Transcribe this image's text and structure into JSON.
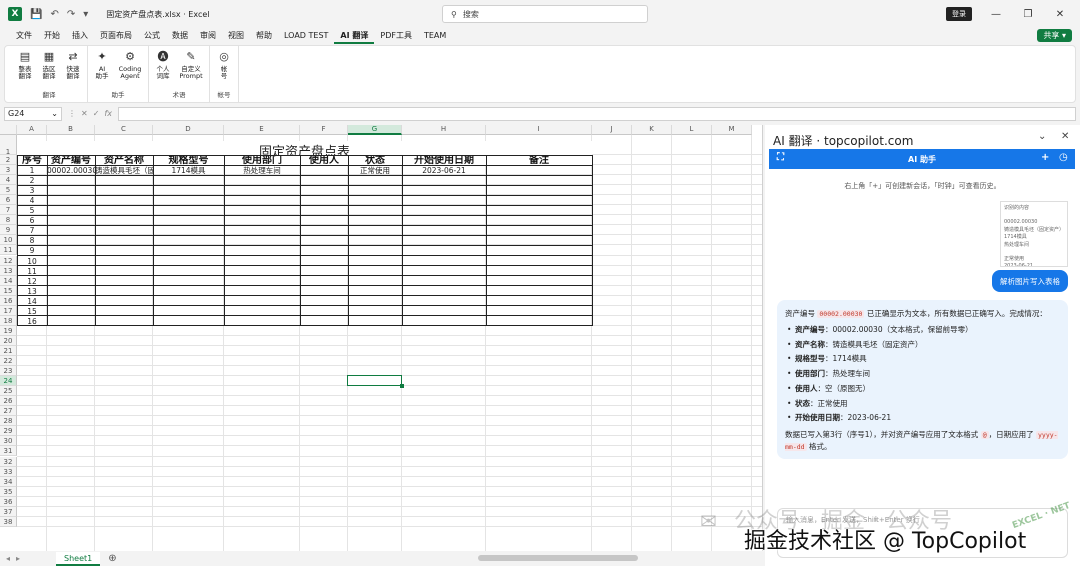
{
  "window": {
    "title": "固定资产盘点表.xlsx · Excel",
    "search_placeholder": "搜索",
    "login_label": "登录",
    "share_label": "共享"
  },
  "menu": [
    "文件",
    "开始",
    "插入",
    "页面布局",
    "公式",
    "数据",
    "审阅",
    "视图",
    "帮助",
    "LOAD TEST",
    "AI 翻译",
    "PDF工具",
    "TEAM"
  ],
  "menu_active": "AI 翻译",
  "ribbon": {
    "groups": [
      {
        "label": "翻译",
        "buttons": [
          [
            "整表",
            "翻译"
          ],
          [
            "选区",
            "翻译"
          ],
          [
            "快速",
            "翻译"
          ]
        ]
      },
      {
        "label": "助手",
        "buttons": [
          [
            "AI",
            "助手"
          ],
          [
            "Coding",
            "Agent"
          ]
        ]
      },
      {
        "label": "术语",
        "buttons": [
          [
            "个人",
            "词库"
          ],
          [
            "自定义",
            "Prompt"
          ]
        ]
      },
      {
        "label": "帐号",
        "buttons": [
          [
            "帐",
            "号"
          ]
        ]
      }
    ]
  },
  "formula": {
    "namebox": "G24",
    "fx": "fx"
  },
  "columns": [
    "A",
    "B",
    "C",
    "D",
    "E",
    "F",
    "G",
    "H",
    "I",
    "J",
    "K",
    "L",
    "M"
  ],
  "sheet": {
    "title": "固定资产盘点表",
    "headers": [
      "序号",
      "资产编号",
      "资产名称",
      "规格型号",
      "使用部门",
      "使用人",
      "状态",
      "开始使用日期",
      "备注"
    ],
    "row1": {
      "seq": "1",
      "code": "00002.00030",
      "name": "铸造模具毛坯（固定资产）",
      "spec": "1714模具",
      "dept": "热处理车间",
      "user": "",
      "status": "正常使用",
      "date": "2023-06-21"
    },
    "seq_numbers": [
      "2",
      "3",
      "4",
      "5",
      "6",
      "7",
      "8",
      "9",
      "10",
      "11",
      "12",
      "13",
      "14",
      "15",
      "16"
    ],
    "tab_name": "Sheet1"
  },
  "panel": {
    "title": "AI 翻译 · topcopilot.com",
    "assistant_title": "AI 助手",
    "hint": "右上角「+」可创建新会话，「时钟」可查看历史。",
    "thumb_lines": [
      "识别的内容",
      "",
      "00002.00030",
      "铸造模具毛坯（固定资产）",
      "1714模具",
      "热处理车间",
      "",
      "正常使用",
      "2023-06-21"
    ],
    "user_message": "解析图片写入表格",
    "reply_intro_a": "资产编号",
    "reply_intro_code": "00002.00030",
    "reply_intro_b": "已正确显示为文本，所有数据已正确写入。完成情况：",
    "reply_items": [
      {
        "k": "资产编号",
        "v": "：00002.00030（文本格式，保留前导零）"
      },
      {
        "k": "资产名称",
        "v": "：铸造模具毛坯（固定资产）"
      },
      {
        "k": "规格型号",
        "v": "：1714模具"
      },
      {
        "k": "使用部门",
        "v": "：热处理车间"
      },
      {
        "k": "使用人",
        "v": "：空（原图无）"
      },
      {
        "k": "状态",
        "v": "：正常使用"
      },
      {
        "k": "开始使用日期",
        "v": "：2023-06-21"
      }
    ],
    "reply_outro_a": "数据已写入第3行（序号1），并对资产编号应用了文本格式",
    "reply_outro_code1": "@",
    "reply_outro_b": "，日期应用了",
    "reply_outro_code2": "yyyy-mm-dd",
    "reply_outro_c": "格式。",
    "input_placeholder": "输入消息，Enter 发送，Shift+Enter 换行"
  },
  "watermark": {
    "line1": "公众号 · 掘金 · 公众号",
    "line2": "掘金技术社区 @ TopCopilot",
    "badge": "EXCEL · NET"
  }
}
